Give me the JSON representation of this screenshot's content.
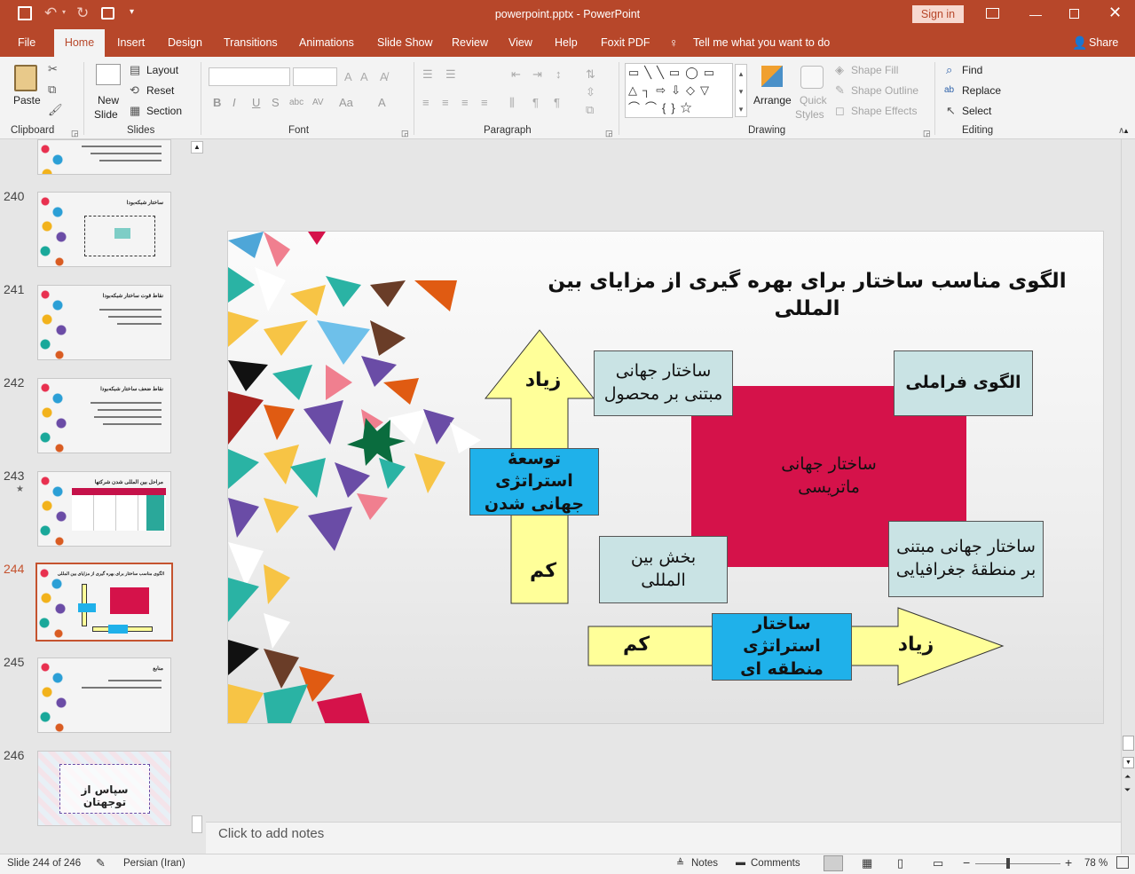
{
  "window": {
    "title": "powerpoint.pptx - PowerPoint",
    "sign_in": "Sign in"
  },
  "tabs": [
    "File",
    "Home",
    "Insert",
    "Design",
    "Transitions",
    "Animations",
    "Slide Show",
    "Review",
    "View",
    "Help",
    "Foxit PDF"
  ],
  "active_tab": "Home",
  "tell_me": "Tell me what you want to do",
  "share": "Share",
  "ribbon": {
    "clipboard": {
      "paste": "Paste",
      "label": "Clipboard"
    },
    "slides": {
      "new_slide": "New",
      "new_slide2": "Slide",
      "layout": "Layout",
      "reset": "Reset",
      "section": "Section",
      "label": "Slides"
    },
    "font": {
      "label": "Font"
    },
    "paragraph": {
      "label": "Paragraph"
    },
    "drawing": {
      "arrange": "Arrange",
      "quick_styles": "Quick",
      "quick_styles2": "Styles",
      "shape_fill": "Shape Fill",
      "shape_outline": "Shape Outline",
      "shape_effects": "Shape Effects",
      "label": "Drawing"
    },
    "editing": {
      "find": "Find",
      "replace": "Replace",
      "select": "Select",
      "label": "Editing"
    }
  },
  "thumbnails": [
    {
      "num": "240",
      "title": "ساختار شبکه‌بودا"
    },
    {
      "num": "241",
      "title": "نقاط قوت ساختار شبکه‌بودا"
    },
    {
      "num": "242",
      "title": "نقاط ضعف ساختار شبکه‌بودا"
    },
    {
      "num": "243",
      "title": "مراحل بین المللی شدن شرکتها"
    },
    {
      "num": "244",
      "title": "الگوی مناسب ساختار برای بهره گیری از مزایای بین المللی"
    },
    {
      "num": "245",
      "title": "منابع"
    },
    {
      "num": "246",
      "title": "سپاس از توجهتان"
    }
  ],
  "slide": {
    "title": "الگوی مناسب ساختار برای بهره گیری از مزایای بین المللی",
    "matrix": "ساختار جهانی ماتریسی",
    "product": "ساختار جهانی مبتنی بر محصول",
    "multinational": "الگوی فراملی",
    "geographic": "ساختار جهانی مبتنی بر منطقهٔ جغرافیایی",
    "international": "بخش بین المللی",
    "y_axis": "توسعهٔ استراتژی جهانی شدن",
    "x_axis": "ساختار استراتژی منطقه ای",
    "high": "زیاد",
    "low": "کم"
  },
  "notes_placeholder": "Click to add notes",
  "status": {
    "slide_info": "Slide 244 of 246",
    "language": "Persian (Iran)",
    "notes": "Notes",
    "comments": "Comments",
    "zoom": "78 %"
  },
  "colors": {
    "accent": "#b7472a",
    "matrix_fill": "#d5124a",
    "label_box": "#c9e3e4",
    "axis_box": "#1fb1ea",
    "arrow_fill": "#ffff99"
  }
}
